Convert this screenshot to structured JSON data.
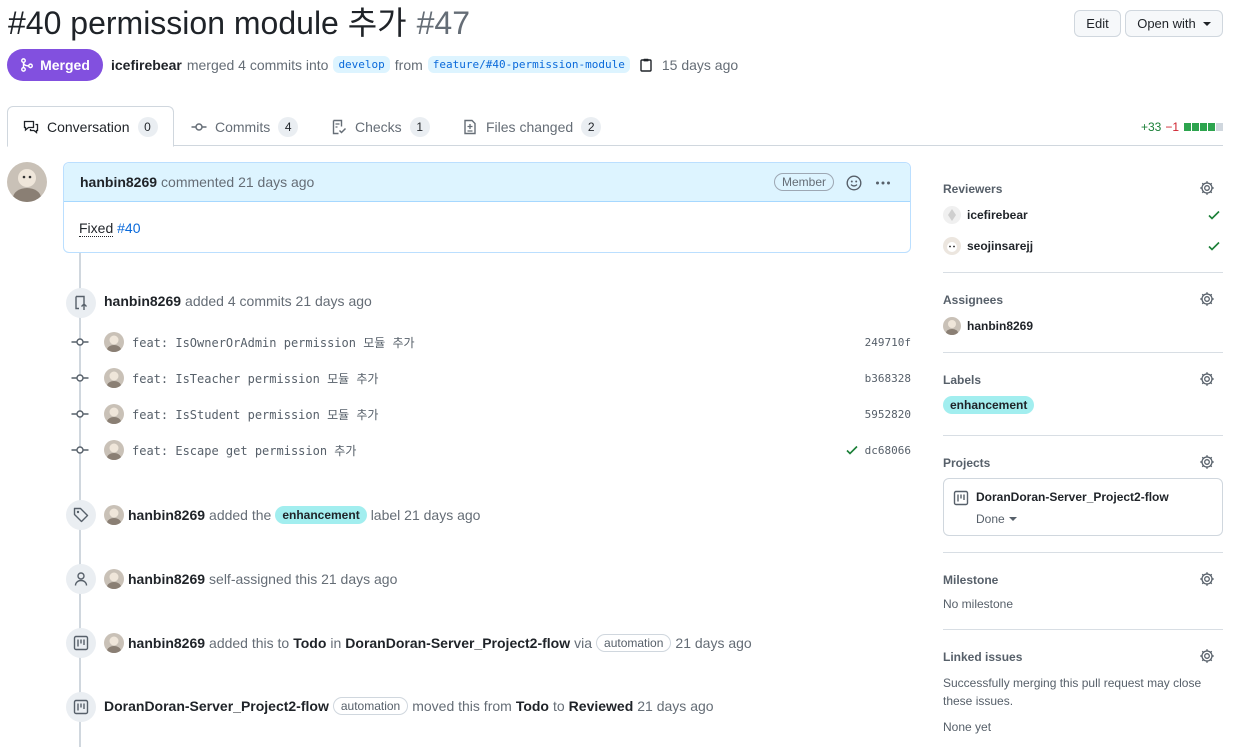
{
  "header": {
    "title": "#40 permission module 추가",
    "number": "#47",
    "edit_label": "Edit",
    "open_with_label": "Open with"
  },
  "status": {
    "label": "Merged",
    "author": "icefirebear",
    "action_text": "merged 4 commits into",
    "base_branch": "develop",
    "from_text": "from",
    "head_branch": "feature/#40-permission-module",
    "time": "15 days ago"
  },
  "tabs": [
    {
      "label": "Conversation",
      "count": "0",
      "icon": "comment-discussion-icon"
    },
    {
      "label": "Commits",
      "count": "4",
      "icon": "commit-icon"
    },
    {
      "label": "Checks",
      "count": "1",
      "icon": "checklist-icon"
    },
    {
      "label": "Files changed",
      "count": "2",
      "icon": "file-diff-icon"
    }
  ],
  "diffstat": {
    "additions": "+33",
    "deletions": "−1",
    "colors": [
      "#2da44e",
      "#2da44e",
      "#2da44e",
      "#2da44e",
      "#d0d7de"
    ]
  },
  "comment": {
    "author": "hanbin8269",
    "action": "commented 21 days ago",
    "role": "Member",
    "body_text": "Fixed",
    "body_link": "#40"
  },
  "commits_event": {
    "author": "hanbin8269",
    "text": "added 4 commits 21 days ago",
    "commits": [
      {
        "message": "feat: IsOwnerOrAdmin permission 모듈 추가",
        "sha": "249710f",
        "checked": false
      },
      {
        "message": "feat: IsTeacher permission 모듈 추가",
        "sha": "b368328",
        "checked": false
      },
      {
        "message": "feat: IsStudent permission 모듈 추가",
        "sha": "5952820",
        "checked": false
      },
      {
        "message": "feat: Escape get permission 추가",
        "sha": "dc68066",
        "checked": true
      }
    ]
  },
  "events": {
    "label_event": {
      "author": "hanbin8269",
      "pre": "added the",
      "label": "enhancement",
      "post": "label 21 days ago"
    },
    "assign_event": {
      "author": "hanbin8269",
      "text": "self-assigned this 21 days ago"
    },
    "project_event": {
      "author": "hanbin8269",
      "pre": "added this to",
      "column": "Todo",
      "in": "in",
      "project": "DoranDoran-Server_Project2-flow",
      "via": "via",
      "bot": "automation",
      "time": "21 days ago"
    },
    "move_event": {
      "project": "DoranDoran-Server_Project2-flow",
      "bot": "automation",
      "pre": "moved this from",
      "from": "Todo",
      "to_word": "to",
      "to": "Reviewed",
      "time": "21 days ago"
    }
  },
  "sidebar": {
    "reviewers": {
      "title": "Reviewers",
      "items": [
        {
          "name": "icefirebear"
        },
        {
          "name": "seojinsarejj"
        }
      ]
    },
    "assignees": {
      "title": "Assignees",
      "items": [
        {
          "name": "hanbin8269"
        }
      ]
    },
    "labels": {
      "title": "Labels",
      "items": [
        {
          "name": "enhancement",
          "color": "#a2eeef"
        }
      ]
    },
    "projects": {
      "title": "Projects",
      "name": "DoranDoran-Server_Project2-flow",
      "status": "Done"
    },
    "milestone": {
      "title": "Milestone",
      "value": "No milestone"
    },
    "linked": {
      "title": "Linked issues",
      "desc": "Successfully merging this pull request may close these issues.",
      "value": "None yet"
    }
  },
  "theme": {
    "merged": "#8250df",
    "link": "#0969da",
    "success": "#1a7f37",
    "label": "#a2eeef"
  }
}
